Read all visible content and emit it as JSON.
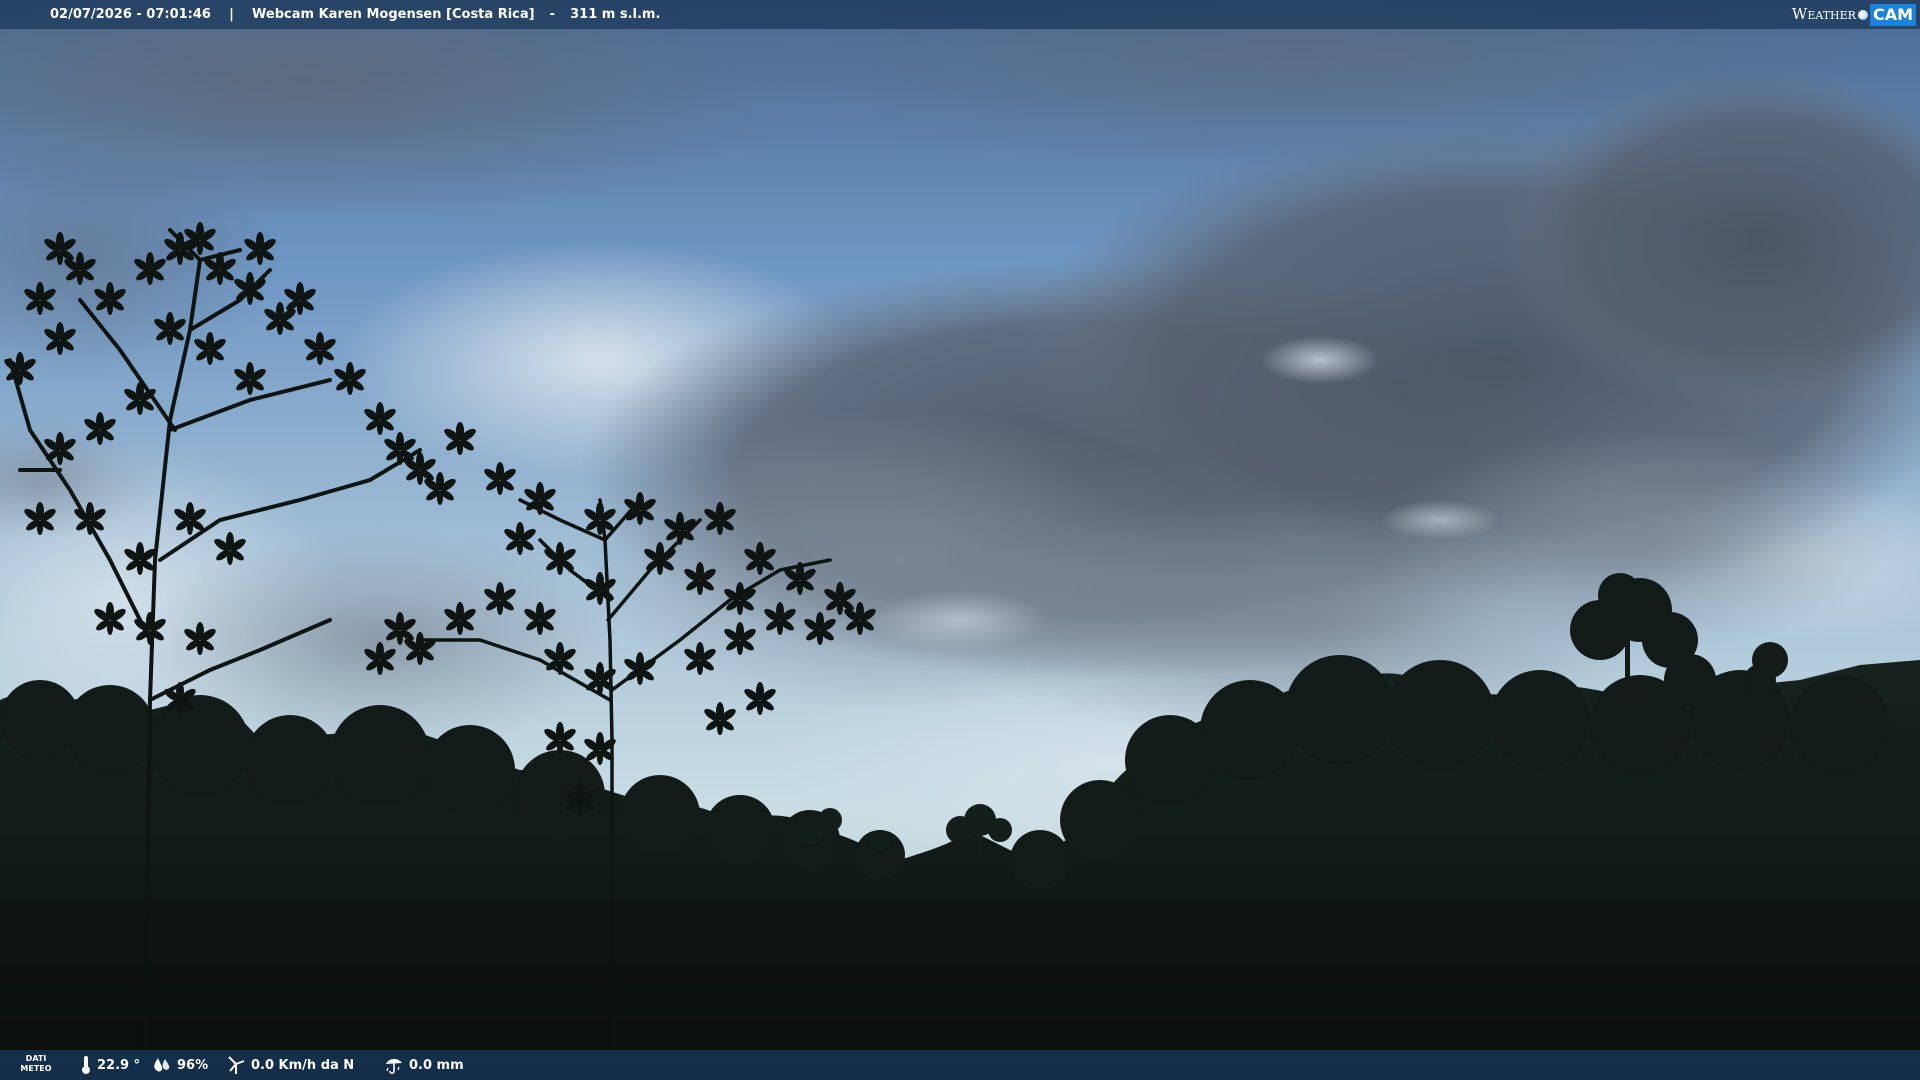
{
  "top_bar": {
    "datetime": "02/07/2026 - 07:01:46",
    "separator": "|",
    "webcam_title": "Webcam Karen Mogensen [Costa Rica]",
    "dash": "-",
    "altitude": "311 m s.l.m."
  },
  "logo": {
    "word": "Weather",
    "cam": "CAM"
  },
  "weather": {
    "label_line1": "DATI",
    "label_line2": "METEO",
    "temperature": "22.9 °",
    "humidity": "96%",
    "wind": "0.0 Km/h da N",
    "rain": "0.0 mm"
  },
  "icons": {
    "temperature": "thermometer-icon",
    "humidity": "humidity-drop-icon",
    "wind": "wind-turbine-icon",
    "rain": "rain-gauge-icon"
  },
  "colors": {
    "bar": "#1c3a5c",
    "logo_accent": "#1c84d8",
    "foliage": "#0f1a16"
  }
}
